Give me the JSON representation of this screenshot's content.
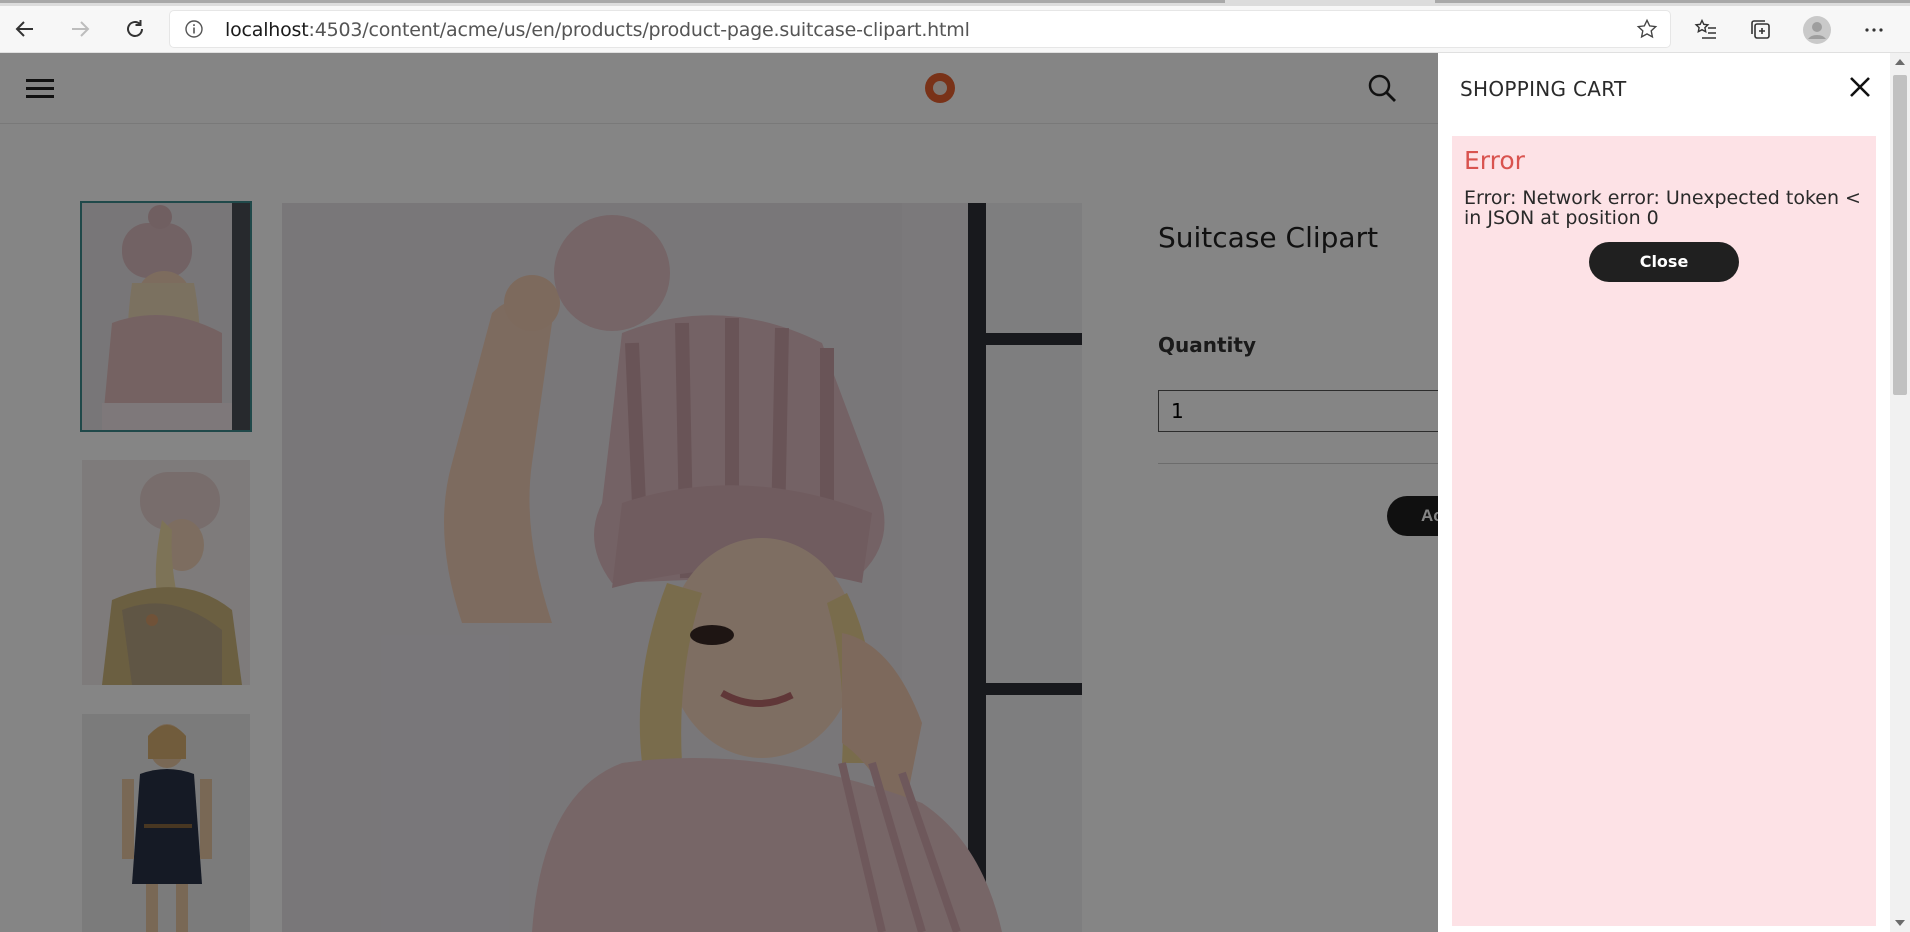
{
  "browser": {
    "url_host": "localhost",
    "url_path": ":4503/content/acme/us/en/products/product-page.suitcase-clipart.html"
  },
  "product": {
    "title": "Suitcase Clipart",
    "quantity_label": "Quantity",
    "quantity_value": "1",
    "add_button_visible": "Ac"
  },
  "cart": {
    "title": "SHOPPING CART",
    "error_title": "Error",
    "error_message": "Error: Network error: Unexpected token < in JSON at position 0",
    "close_label": "Close"
  },
  "colors": {
    "brand_logo": "#e8602f",
    "error_bg": "#fde2e6",
    "error_title": "#d9534f",
    "button_dark": "#202020"
  }
}
